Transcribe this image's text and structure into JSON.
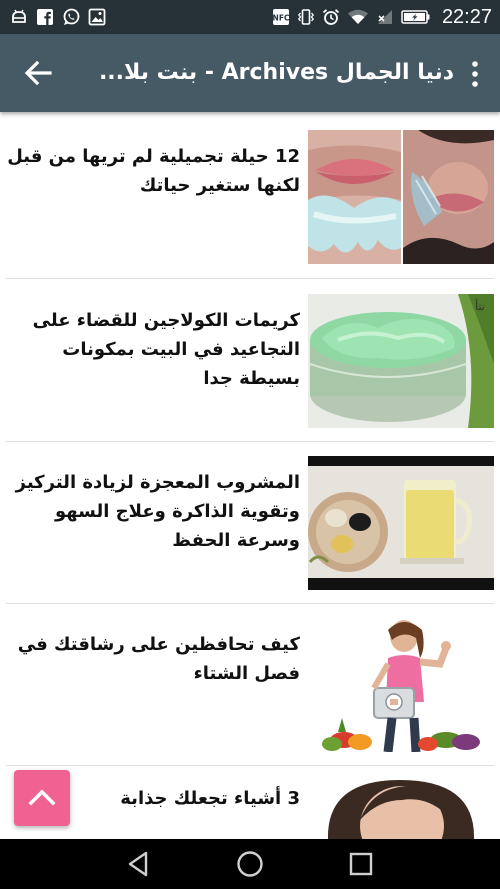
{
  "status_bar": {
    "time": "22:27",
    "left_icons": [
      "android-debug-icon",
      "facebook-icon",
      "whatsapp-icon",
      "gallery-icon"
    ],
    "right_icons": [
      "nfc-icon",
      "vibrate-icon",
      "alarm-icon",
      "wifi-icon",
      "no-signal-icon",
      "battery-charging-icon"
    ]
  },
  "app_bar": {
    "title": "دنيا الجمال Archives - بنت بلا...",
    "back_icon": "arrow-back-icon",
    "menu_icon": "more-vert-icon",
    "background": "#455a64"
  },
  "articles": [
    {
      "title": "12 حيلة تجميلية لم تريها من قبل لكنها ستغير حياتك",
      "thumbnail": "lips-mask-photo"
    },
    {
      "title": "كريمات الكولاجين للقضاء على التجاعيد في البيت بمكونات بسيطة جدا",
      "thumbnail": "green-cream-jar-photo"
    },
    {
      "title": "المشروب المعجزة لزيادة التركيز وتقوية الذاكرة وعلاج السهو وسرعة الحفظ",
      "thumbnail": "drink-and-seeds-photo"
    },
    {
      "title": "كيف تحافظين على رشاقتك في فصل الشتاء",
      "thumbnail": "woman-with-scale-photo"
    },
    {
      "title": "3 أشياء تجعلك جذابة",
      "thumbnail": "woman-face-photo"
    }
  ],
  "fab": {
    "icon": "chevron-up-icon",
    "color": "#f06292"
  },
  "nav_bar": {
    "icons": [
      "nav-back-icon",
      "nav-home-icon",
      "nav-recents-icon"
    ]
  }
}
